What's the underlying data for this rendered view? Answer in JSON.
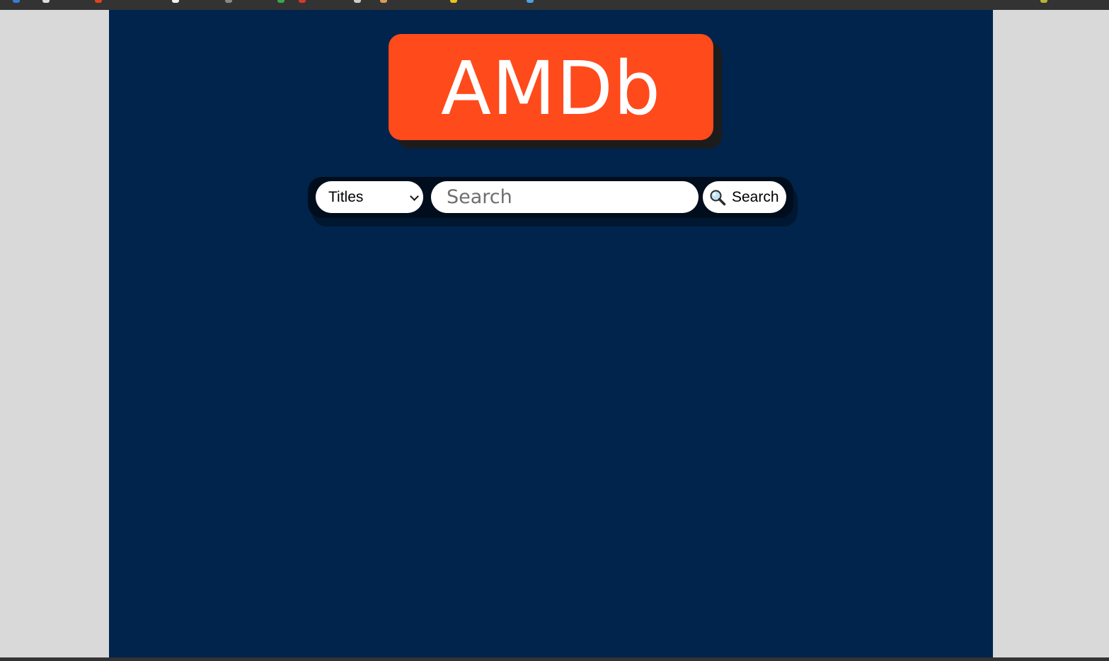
{
  "brand": {
    "name": "AMDb",
    "color": "#ff4a1c"
  },
  "page": {
    "background_color": "#00244b"
  },
  "search": {
    "category_selected": "Titles",
    "input_placeholder": "Search",
    "input_value": "",
    "button_label": "Search",
    "button_icon": "magnifier-icon"
  }
}
